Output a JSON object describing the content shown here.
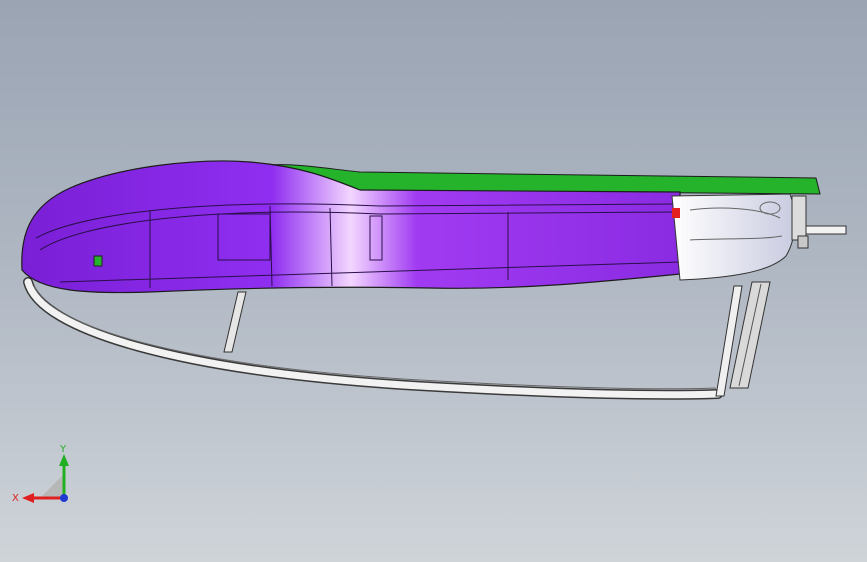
{
  "viewport": {
    "background_top": "#9aa4b3",
    "background_bottom": "#cfd4d9"
  },
  "model": {
    "colors": {
      "body_purple": "#8a2be2",
      "body_highlight": "#e9c7ff",
      "top_green": "#25b32b",
      "end_cap_white": "#eceef4",
      "rail_light": "#f2f2f2",
      "outline": "#2a2a2a"
    }
  },
  "triad": {
    "x_label": "X",
    "y_label": "Y",
    "x_color": "#e02020",
    "y_color": "#22b022",
    "z_color": "#1e3ad0"
  }
}
